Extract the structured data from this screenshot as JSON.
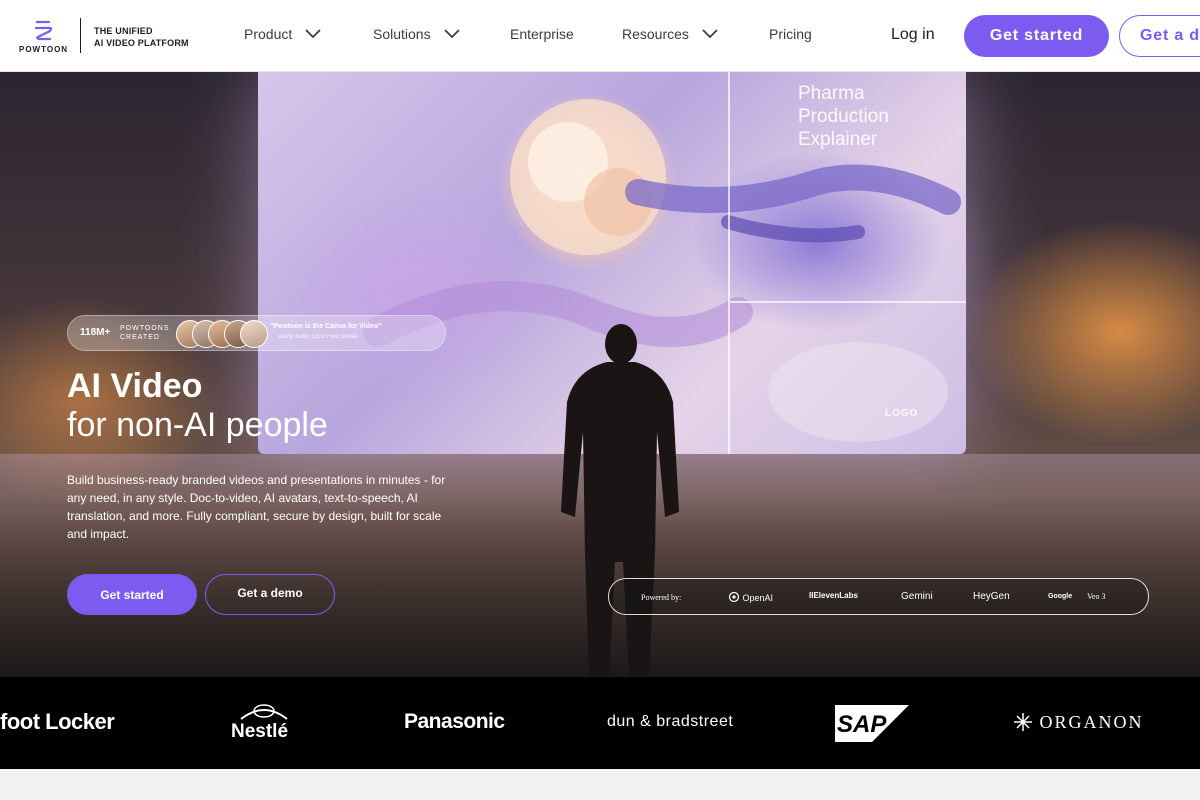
{
  "header": {
    "logo_text": "POWTOON",
    "tagline_line1": "THE UNIFIED",
    "tagline_line2": "AI VIDEO PLATFORM",
    "nav": [
      {
        "label": "Product",
        "has_dropdown": true
      },
      {
        "label": "Solutions",
        "has_dropdown": true
      },
      {
        "label": "Enterprise",
        "has_dropdown": false
      },
      {
        "label": "Resources",
        "has_dropdown": true
      },
      {
        "label": "Pricing",
        "has_dropdown": false
      }
    ],
    "login_label": "Log in",
    "cta_primary": "Get started",
    "cta_secondary": "Get a demo"
  },
  "hero": {
    "screen": {
      "title_line1": "Pharma",
      "title_line2": "Production",
      "title_line3": "Explainer",
      "logo_text": "LOGO"
    },
    "social_proof": {
      "count": "118M+",
      "label_line1": "POWTOONS",
      "label_line2": "CREATED",
      "quote": "\"Powtoon is the Canva for Video\"",
      "author": "David Suter, CEO Fold Sense"
    },
    "heading_bold": "AI Video",
    "heading_light": "for non-AI people",
    "description": "Build business-ready branded videos and presentations in minutes - for any need, in any style. Doc-to-video, AI avatars, text-to-speech, AI translation, and more. Fully compliant, secure by design, built for scale and impact.",
    "cta_primary": "Get started",
    "cta_secondary": "Get a demo",
    "powered_by": {
      "label": "Powered by:",
      "brands": [
        "OpenAI",
        "IIElevenLabs",
        "Gemini",
        "HeyGen",
        "Google",
        "Veo 3"
      ]
    }
  },
  "logos_strip": {
    "brands": [
      "foot Locker",
      "Nestlé",
      "Panasonic",
      "dun & bradstreet",
      "SAP",
      "ORGANON"
    ]
  },
  "colors": {
    "accent": "#7c5cf0",
    "header_bg": "#ffffff",
    "logos_bg": "#000000",
    "text_dark": "#1d1d2a"
  }
}
